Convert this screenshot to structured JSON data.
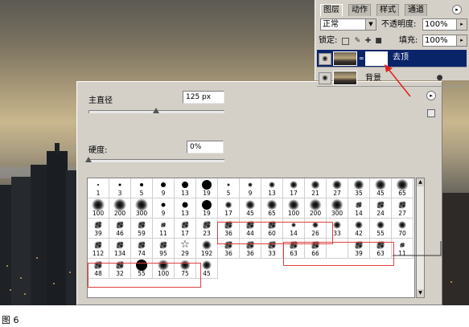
{
  "brushes_panel": {
    "master_diameter_label": "主直径",
    "master_diameter_value": "125 px",
    "diameter_slider": 0.5,
    "hardness_label": "硬度:",
    "hardness_value": "0%",
    "hardness_slider": 0.0,
    "presets": [
      {
        "size": "1",
        "style": "hard",
        "d": 2
      },
      {
        "size": "3",
        "style": "hard",
        "d": 3
      },
      {
        "size": "5",
        "style": "hard",
        "d": 4
      },
      {
        "size": "9",
        "style": "hard",
        "d": 6
      },
      {
        "size": "13",
        "style": "hard",
        "d": 8
      },
      {
        "size": "19",
        "style": "hard",
        "d": 12
      },
      {
        "size": "5",
        "style": "soft",
        "d": 4
      },
      {
        "size": "9",
        "style": "soft",
        "d": 6
      },
      {
        "size": "13",
        "style": "soft",
        "d": 8
      },
      {
        "size": "17",
        "style": "soft",
        "d": 10
      },
      {
        "size": "21",
        "style": "soft",
        "d": 11
      },
      {
        "size": "27",
        "style": "soft",
        "d": 12
      },
      {
        "size": "35",
        "style": "soft",
        "d": 13
      },
      {
        "size": "45",
        "style": "soft",
        "d": 14
      },
      {
        "size": "65",
        "style": "soft",
        "d": 15
      },
      {
        "size": "100",
        "style": "soft",
        "d": 16
      },
      {
        "size": "200",
        "style": "soft",
        "d": 16
      },
      {
        "size": "300",
        "style": "soft",
        "d": 16
      },
      {
        "size": "9",
        "style": "hard",
        "d": 5
      },
      {
        "size": "13",
        "style": "hard",
        "d": 7
      },
      {
        "size": "19",
        "style": "hard",
        "d": 12
      },
      {
        "size": "17",
        "style": "soft",
        "d": 9
      },
      {
        "size": "45",
        "style": "soft",
        "d": 12
      },
      {
        "size": "65",
        "style": "soft",
        "d": 13
      },
      {
        "size": "100",
        "style": "soft",
        "d": 14
      },
      {
        "size": "200",
        "style": "soft",
        "d": 15
      },
      {
        "size": "300",
        "style": "soft",
        "d": 15
      },
      {
        "size": "14",
        "style": "tex",
        "d": 10
      },
      {
        "size": "24",
        "style": "tex",
        "d": 12
      },
      {
        "size": "27",
        "style": "tex",
        "d": 12
      },
      {
        "size": "39",
        "style": "tex",
        "d": 12
      },
      {
        "size": "46",
        "style": "tex",
        "d": 12
      },
      {
        "size": "59",
        "style": "tex",
        "d": 12
      },
      {
        "size": "11",
        "style": "tex",
        "d": 8
      },
      {
        "size": "17",
        "style": "tex",
        "d": 12
      },
      {
        "size": "23",
        "style": "tex",
        "d": 13
      },
      {
        "size": "36",
        "style": "tex",
        "d": 13
      },
      {
        "size": "44",
        "style": "tex",
        "d": 13
      },
      {
        "size": "60",
        "style": "tex",
        "d": 13
      },
      {
        "size": "14",
        "style": "soft",
        "d": 6
      },
      {
        "size": "26",
        "style": "soft",
        "d": 8
      },
      {
        "size": "33",
        "style": "soft",
        "d": 10
      },
      {
        "size": "42",
        "style": "soft",
        "d": 10
      },
      {
        "size": "55",
        "style": "soft",
        "d": 10
      },
      {
        "size": "70",
        "style": "soft",
        "d": 10
      },
      {
        "size": "112",
        "style": "tex",
        "d": 12
      },
      {
        "size": "134",
        "style": "tex",
        "d": 12
      },
      {
        "size": "74",
        "style": "tex",
        "d": 12
      },
      {
        "size": "95",
        "style": "tex",
        "d": 12
      },
      {
        "size": "29",
        "style": "star",
        "d": 12
      },
      {
        "size": "192",
        "style": "soft",
        "d": 12
      },
      {
        "size": "36",
        "style": "tex",
        "d": 13
      },
      {
        "size": "36",
        "style": "tex",
        "d": 13
      },
      {
        "size": "33",
        "style": "tex",
        "d": 13
      },
      {
        "size": "63",
        "style": "tex",
        "d": 13
      },
      {
        "size": "66",
        "style": "tex",
        "d": 13
      },
      {
        "size": "",
        "style": "none",
        "d": 0
      },
      {
        "size": "39",
        "style": "tex",
        "d": 13
      },
      {
        "size": "63",
        "style": "tex",
        "d": 13
      },
      {
        "size": "11",
        "style": "tex",
        "d": 8
      },
      {
        "size": "48",
        "style": "tex",
        "d": 13
      },
      {
        "size": "32",
        "style": "tex",
        "d": 13
      },
      {
        "size": "55",
        "style": "hard",
        "d": 14
      },
      {
        "size": "100",
        "style": "soft",
        "d": 14
      },
      {
        "size": "75",
        "style": "soft",
        "d": 13
      },
      {
        "size": "45",
        "style": "soft",
        "d": 12
      }
    ]
  },
  "layers_panel": {
    "tabs": [
      "图层",
      "动作",
      "样式",
      "通道"
    ],
    "blend_mode": "正常",
    "opacity_label": "不透明度:",
    "opacity_value": "100%",
    "lock_label": "锁定:",
    "fill_label": "填充:",
    "fill_value": "100%",
    "layers": [
      {
        "name": "去顶",
        "selected": true
      },
      {
        "name": "背景",
        "selected": false
      }
    ]
  },
  "colors": {
    "panel_bg": "#d4d0c8",
    "selection": "#0a246a",
    "highlight_box": "#e04040"
  },
  "caption": "图 6"
}
